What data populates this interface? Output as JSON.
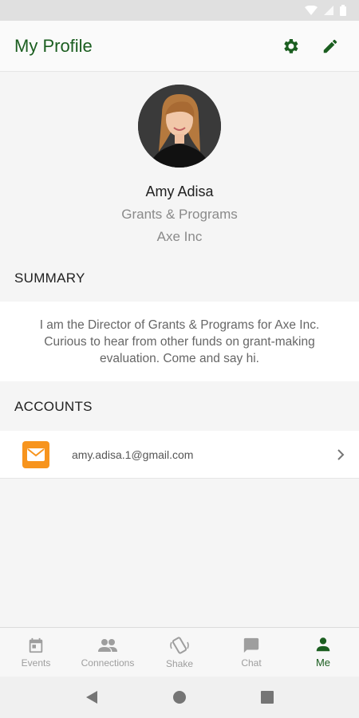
{
  "app_bar": {
    "title": "My Profile",
    "actions": [
      {
        "icon": "gear-icon"
      },
      {
        "icon": "pencil-icon"
      }
    ]
  },
  "profile": {
    "name": "Amy Adisa",
    "title": "Grants & Programs",
    "company": "Axe Inc"
  },
  "summary": {
    "heading": "SUMMARY",
    "text": "I am the Director of Grants & Programs for Axe Inc. Curious to hear from other funds on grant-making evaluation. Come and say hi."
  },
  "accounts": {
    "heading": "ACCOUNTS",
    "items": [
      {
        "icon": "mail-icon",
        "email": "amy.adisa.1@gmail.com"
      }
    ]
  },
  "bottom_nav": {
    "items": [
      {
        "label": "Events",
        "icon": "calendar-icon",
        "active": false
      },
      {
        "label": "Connections",
        "icon": "people-icon",
        "active": false
      },
      {
        "label": "Shake",
        "icon": "shake-phone-icon",
        "active": false
      },
      {
        "label": "Chat",
        "icon": "chat-icon",
        "active": false
      },
      {
        "label": "Me",
        "icon": "person-icon",
        "active": true
      }
    ]
  },
  "colors": {
    "accent": "#1b5e20",
    "mail_badge": "#f7941d",
    "inactive": "#9e9e9e"
  }
}
